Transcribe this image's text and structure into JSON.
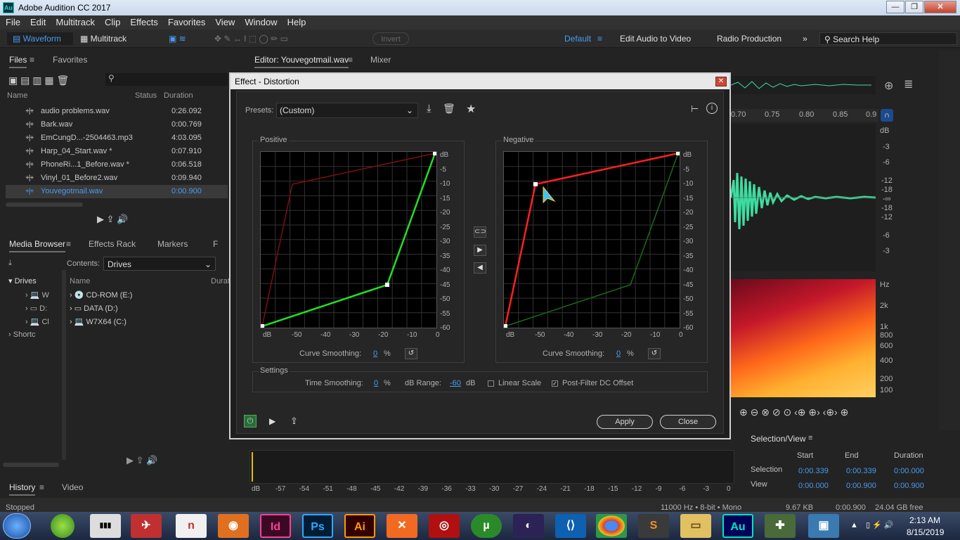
{
  "app": {
    "title": "Adobe Audition CC 2017",
    "icon_text": "Au"
  },
  "window_controls": {
    "minimize": "—",
    "maximize": "❐",
    "close": "✕"
  },
  "menu": [
    "File",
    "Edit",
    "Multitrack",
    "Clip",
    "Effects",
    "Favorites",
    "View",
    "Window",
    "Help"
  ],
  "toolbar": {
    "waveform": "Waveform",
    "multitrack": "Multitrack",
    "invert": "Invert",
    "workspaces": [
      "Default",
      "Edit Audio to Video",
      "Radio Production"
    ],
    "search_placeholder": "Search Help"
  },
  "files_panel": {
    "tabs": [
      "Files",
      "Favorites"
    ],
    "headers": {
      "name": "Name",
      "status": "Status",
      "duration": "Duration"
    },
    "files": [
      {
        "name": "audio problems.wav",
        "duration": "0:26.092"
      },
      {
        "name": "Bark.wav",
        "duration": "0:00.769"
      },
      {
        "name": "EmCungD...-2504463.mp3",
        "duration": "4:03.095"
      },
      {
        "name": "Harp_04_Start.wav *",
        "duration": "0:07.910"
      },
      {
        "name": "PhoneRi...1_Before.wav *",
        "duration": "0:06.518"
      },
      {
        "name": "Vinyl_01_Before2.wav",
        "duration": "0:09.940"
      },
      {
        "name": "Youvegotmail.wav",
        "duration": "0:00.900",
        "selected": true
      }
    ]
  },
  "media_browser": {
    "tabs": [
      "Media Browser",
      "Effects Rack",
      "Markers",
      "F"
    ],
    "contents_label": "Contents:",
    "contents_value": "Drives",
    "tree": [
      "Drives",
      "W",
      "D:",
      "Cl",
      "Shortc"
    ],
    "headers": {
      "name": "Name",
      "duration": "Durat"
    },
    "drives": [
      "CD-ROM (E:)",
      "DATA (D:)",
      "W7X64 (C:)"
    ]
  },
  "history": {
    "tabs": [
      "History",
      "Video"
    ],
    "status": "Stopped"
  },
  "editor": {
    "tab": "Editor: Youvegotmail.wav",
    "mixer": "Mixer"
  },
  "ruler": [
    "0.70",
    "0.75",
    "0.80",
    "0.85",
    "0.9"
  ],
  "db_scale": [
    "dB",
    "-3",
    "-6",
    "-12",
    "-18",
    "-∞",
    "-18",
    "-12",
    "-6",
    "-3"
  ],
  "hz_scale": [
    "Hz",
    "2k",
    "1k",
    "800",
    "600",
    "400",
    "200",
    "100"
  ],
  "bottom_meter": [
    "dB",
    "-57",
    "-54",
    "-51",
    "-48",
    "-45",
    "-42",
    "-39",
    "-36",
    "-33",
    "-30",
    "-27",
    "-24",
    "-21",
    "-18",
    "-15",
    "-12",
    "-9",
    "-6",
    "-3",
    "0"
  ],
  "selection_view": {
    "title": "Selection/View",
    "cols": [
      "Start",
      "End",
      "Duration"
    ],
    "selection": {
      "label": "Selection",
      "start": "0:00.339",
      "end": "0:00.339",
      "duration": "0:00.000"
    },
    "view": {
      "label": "View",
      "start": "0:00.000",
      "end": "0:00.900",
      "duration": "0:00.900"
    }
  },
  "statusbar": {
    "format": "11000 Hz • 8-bit • Mono",
    "size": "9.67 KB",
    "duration": "0:00.900",
    "free": "24.04 GB free"
  },
  "dialog": {
    "title": "Effect - Distortion",
    "presets_label": "Presets:",
    "preset_value": "(Custom)",
    "positive": "Positive",
    "negative": "Negative",
    "graph_y": [
      "dB",
      "-5",
      "-10",
      "-15",
      "-20",
      "-25",
      "-30",
      "-35",
      "-40",
      "-45",
      "-50",
      "-55",
      "-60"
    ],
    "graph_x": [
      "dB",
      "-50",
      "-40",
      "-30",
      "-20",
      "-10",
      "0"
    ],
    "curve_smoothing_label": "Curve Smoothing:",
    "curve_smoothing_pos": "0",
    "curve_smoothing_neg": "0",
    "percent": "%",
    "settings": "Settings",
    "time_smoothing_label": "Time Smoothing:",
    "time_smoothing_value": "0",
    "db_range_label": "dB Range:",
    "db_range_value": "-60",
    "db_unit": "dB",
    "linear_scale": "Linear Scale",
    "post_filter": "Post-Filter DC Offset",
    "apply": "Apply",
    "close": "Close"
  },
  "taskbar": {
    "apps": [
      "Ps",
      "Ai",
      "Id",
      "Au"
    ],
    "time": "2:13 AM",
    "date": "8/15/2019"
  },
  "colors": {
    "accent": "#4a9bf0",
    "positive_curve": "#22e022",
    "negative_curve": "#ff2020",
    "waveform": "#3ddca0"
  }
}
